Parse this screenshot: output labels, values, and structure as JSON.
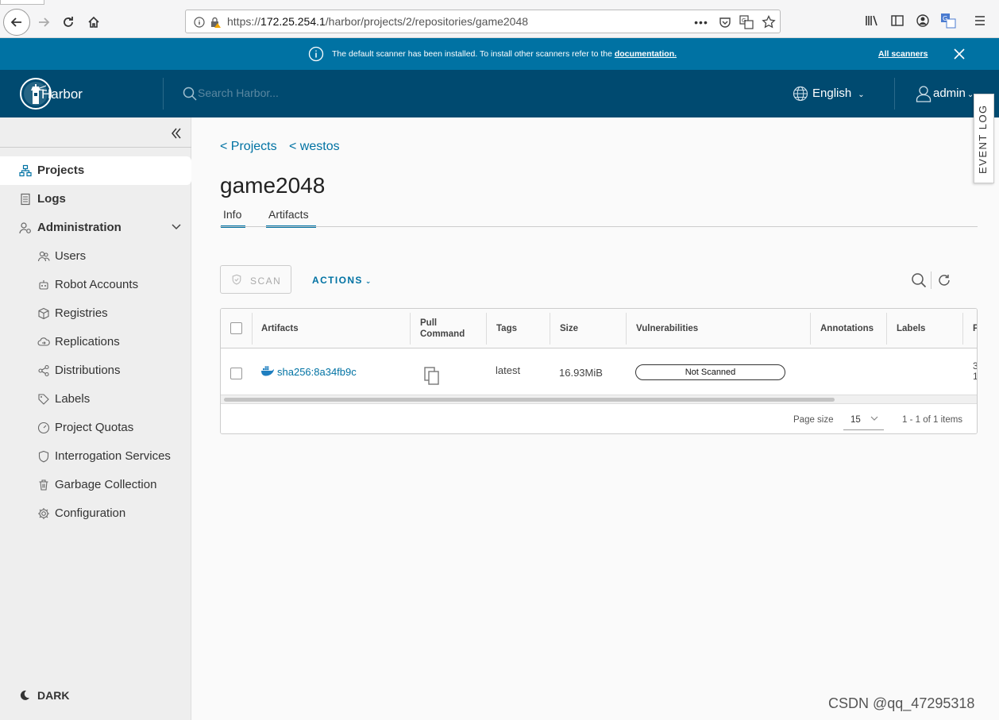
{
  "browser": {
    "url_prefix": "https://",
    "url_host": "172.25.254.1",
    "url_path": "/harbor/projects/2/repositories/game2048"
  },
  "banner": {
    "message": "The default scanner has been installed. To install other scanners refer to the ",
    "link": "documentation.",
    "all_scanners": "All scanners"
  },
  "header": {
    "app_name": "Harbor",
    "search_placeholder": "Search Harbor...",
    "language": "English",
    "user": "admin",
    "event_log": "EVENT LOG"
  },
  "sidebar": {
    "projects": "Projects",
    "logs": "Logs",
    "administration": "Administration",
    "items": [
      {
        "label": "Users",
        "icon": "users-icon"
      },
      {
        "label": "Robot Accounts",
        "icon": "robot-icon"
      },
      {
        "label": "Registries",
        "icon": "cube-icon"
      },
      {
        "label": "Replications",
        "icon": "cloud-sync-icon"
      },
      {
        "label": "Distributions",
        "icon": "share-icon"
      },
      {
        "label": "Labels",
        "icon": "tag-icon"
      },
      {
        "label": "Project Quotas",
        "icon": "dashboard-icon"
      },
      {
        "label": "Interrogation Services",
        "icon": "shield-icon"
      },
      {
        "label": "Garbage Collection",
        "icon": "trash-icon"
      },
      {
        "label": "Configuration",
        "icon": "gear-icon"
      }
    ],
    "dark_mode": "DARK"
  },
  "main": {
    "breadcrumb": [
      "< Projects",
      "< westos"
    ],
    "title": "game2048",
    "tabs": [
      "Info",
      "Artifacts"
    ],
    "active_tab": "Artifacts",
    "scan_label": "SCAN",
    "actions_label": "ACTIONS"
  },
  "grid": {
    "columns": [
      "Artifacts",
      "Pull\nCommand",
      "Tags",
      "Size",
      "Vulnerabilities",
      "Annotations",
      "Labels",
      "P"
    ],
    "rows": [
      {
        "artifact": "sha256:8a34fb9c",
        "tags": "latest",
        "size": "16.93MiB",
        "vulnerabilities": "Not Scanned",
        "push_time_partial": [
          "3",
          "1"
        ]
      }
    ],
    "page_size_label": "Page size",
    "page_size": "15",
    "item_count": "1 - 1 of 1 items"
  },
  "watermark": "CSDN @qq_47295318",
  "colors": {
    "banner": "#0072a3",
    "header": "#004a70",
    "link": "#0072a3"
  }
}
